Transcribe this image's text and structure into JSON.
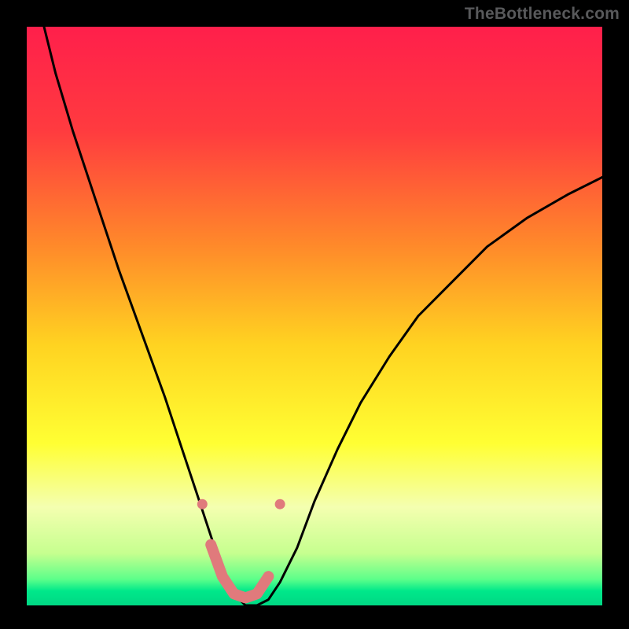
{
  "watermark": "TheBottleneck.com",
  "chart_data": {
    "type": "line",
    "title": "",
    "xlabel": "",
    "ylabel": "",
    "xlim": [
      0,
      100
    ],
    "ylim": [
      0,
      100
    ],
    "grid": false,
    "background_gradient": [
      {
        "stop": 0.0,
        "color": "#ff1f4b"
      },
      {
        "stop": 0.18,
        "color": "#ff3b3f"
      },
      {
        "stop": 0.38,
        "color": "#ff8a2a"
      },
      {
        "stop": 0.55,
        "color": "#ffd321"
      },
      {
        "stop": 0.72,
        "color": "#ffff33"
      },
      {
        "stop": 0.83,
        "color": "#f4ffb0"
      },
      {
        "stop": 0.91,
        "color": "#c6ff8f"
      },
      {
        "stop": 0.955,
        "color": "#5cff8a"
      },
      {
        "stop": 0.975,
        "color": "#00e88a"
      },
      {
        "stop": 1.0,
        "color": "#00d884"
      }
    ],
    "series": [
      {
        "name": "bottleneck-curve",
        "stroke": "#000000",
        "stroke_width": 3,
        "x": [
          3,
          5,
          8,
          12,
          16,
          20,
          24,
          27,
          30,
          32,
          34,
          36,
          38,
          40,
          42,
          44,
          47,
          50,
          54,
          58,
          63,
          68,
          74,
          80,
          87,
          94,
          100
        ],
        "y": [
          100,
          92,
          82,
          70,
          58,
          47,
          36,
          27,
          18,
          12,
          6,
          2,
          0,
          0,
          1,
          4,
          10,
          18,
          27,
          35,
          43,
          50,
          56,
          62,
          67,
          71,
          74
        ]
      }
    ],
    "markers": {
      "color": "#e07a7c",
      "dot_radius": 6.5,
      "thick_stroke_width": 14,
      "dots_x": [
        30.5,
        44.0
      ],
      "dots_y": [
        17.5,
        17.5
      ],
      "thick_segment": {
        "x": [
          32.0,
          34.0,
          36.0,
          38.0,
          40.0,
          42.0
        ],
        "y": [
          10.5,
          5.0,
          2.0,
          1.3,
          2.0,
          5.0
        ]
      }
    }
  }
}
